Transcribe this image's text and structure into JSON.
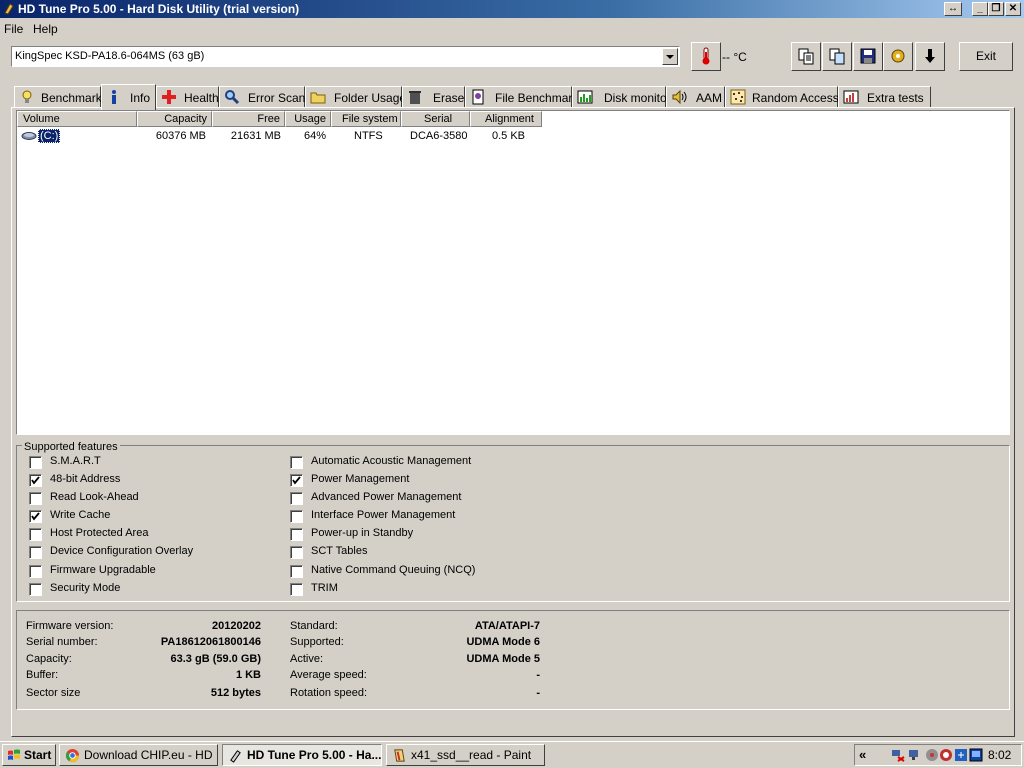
{
  "window": {
    "title": "HD Tune Pro 5.00 - Hard Disk Utility (trial version)"
  },
  "menu": {
    "file": "File",
    "help": "Help"
  },
  "toolbar": {
    "drive": "KingSpec KSD-PA18.6-064MS (63 gB)",
    "temperature": "-- °C",
    "exit_label": "Exit",
    "icons": [
      "copy-text-icon",
      "copy-screenshot-icon",
      "save-icon",
      "options-icon",
      "download-icon"
    ]
  },
  "tabs": [
    {
      "label": "Benchmark",
      "icon": "benchmark-icon"
    },
    {
      "label": "Info",
      "icon": "info-icon",
      "active": true
    },
    {
      "label": "Health",
      "icon": "health-icon"
    },
    {
      "label": "Error Scan",
      "icon": "error-scan-icon"
    },
    {
      "label": "Folder Usage",
      "icon": "folder-usage-icon"
    },
    {
      "label": "Erase",
      "icon": "erase-icon"
    },
    {
      "label": "File Benchmark",
      "icon": "file-benchmark-icon"
    },
    {
      "label": "Disk monitor",
      "icon": "disk-monitor-icon"
    },
    {
      "label": "AAM",
      "icon": "aam-icon"
    },
    {
      "label": "Random Access",
      "icon": "random-access-icon"
    },
    {
      "label": "Extra tests",
      "icon": "extra-tests-icon"
    }
  ],
  "volumes": {
    "headers": [
      "Volume",
      "Capacity",
      "Free",
      "Usage",
      "File system",
      "Serial",
      "Alignment"
    ],
    "rows": [
      {
        "volume": "(C:)",
        "capacity": "60376 MB",
        "free": "21631 MB",
        "usage": "64%",
        "filesystem": "NTFS",
        "serial": "DCA6-3580",
        "alignment": "0.5 KB"
      }
    ]
  },
  "features": {
    "title": "Supported features",
    "left": [
      {
        "label": "S.M.A.R.T",
        "checked": false
      },
      {
        "label": "48-bit Address",
        "checked": true
      },
      {
        "label": "Read Look-Ahead",
        "checked": false
      },
      {
        "label": "Write Cache",
        "checked": true
      },
      {
        "label": "Host Protected Area",
        "checked": false
      },
      {
        "label": "Device Configuration Overlay",
        "checked": false
      },
      {
        "label": "Firmware Upgradable",
        "checked": false
      },
      {
        "label": "Security Mode",
        "checked": false
      }
    ],
    "right": [
      {
        "label": "Automatic Acoustic Management",
        "checked": false
      },
      {
        "label": "Power Management",
        "checked": true
      },
      {
        "label": "Advanced Power Management",
        "checked": false
      },
      {
        "label": "Interface Power Management",
        "checked": false
      },
      {
        "label": "Power-up in Standby",
        "checked": false
      },
      {
        "label": "SCT Tables",
        "checked": false
      },
      {
        "label": "Native Command Queuing (NCQ)",
        "checked": false
      },
      {
        "label": "TRIM",
        "checked": false
      }
    ]
  },
  "info": {
    "left": [
      {
        "label": "Firmware version:",
        "value": "20120202"
      },
      {
        "label": "Serial number:",
        "value": "PA18612061800146"
      },
      {
        "label": "Capacity:",
        "value": "63.3 gB (59.0 GB)"
      },
      {
        "label": "Buffer:",
        "value": "1 KB"
      },
      {
        "label": "Sector size",
        "value": "512 bytes"
      }
    ],
    "right": [
      {
        "label": "Standard:",
        "value": "ATA/ATAPI-7"
      },
      {
        "label": "Supported:",
        "value": "UDMA Mode 6"
      },
      {
        "label": "Active:",
        "value": "UDMA Mode 5"
      },
      {
        "label": "Average speed:",
        "value": "-"
      },
      {
        "label": "Rotation speed:",
        "value": "-"
      }
    ]
  },
  "taskbar": {
    "start": "Start",
    "tasks": [
      {
        "label": "Download CHIP.eu - HD ...",
        "icon": "chrome-icon"
      },
      {
        "label": "HD Tune Pro 5.00 - Ha...",
        "icon": "hdtune-icon",
        "active": true
      },
      {
        "label": "x41_ssd__read - Paint",
        "icon": "paint-icon"
      }
    ],
    "tray_chevron": "«",
    "clock": "8:02"
  }
}
